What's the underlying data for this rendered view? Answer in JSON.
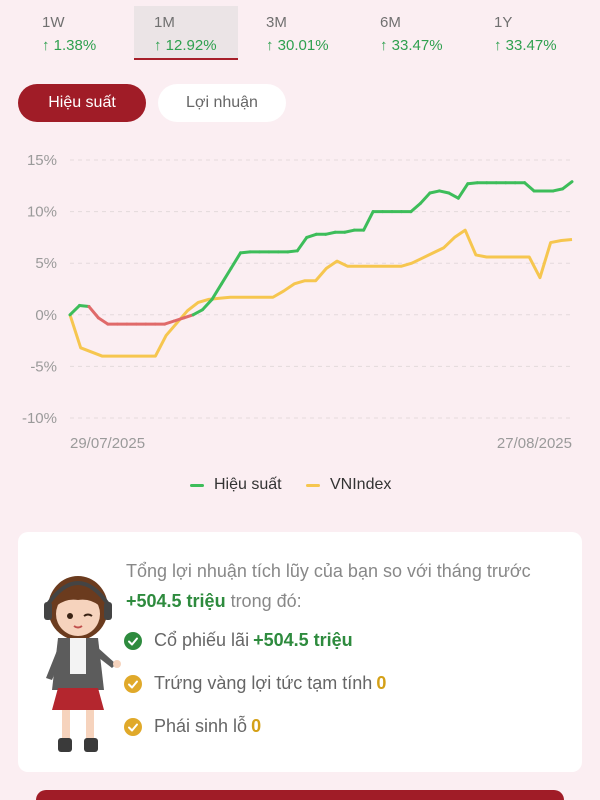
{
  "periods": [
    {
      "label": "1W",
      "change": "↑ 1.38%"
    },
    {
      "label": "1M",
      "change": "↑ 12.92%"
    },
    {
      "label": "3M",
      "change": "↑ 30.01%"
    },
    {
      "label": "6M",
      "change": "↑ 33.47%"
    },
    {
      "label": "1Y",
      "change": "↑ 33.47%"
    }
  ],
  "tabs": {
    "performance": "Hiệu suất",
    "profit": "Lợi nhuận"
  },
  "chart_data": {
    "type": "line",
    "y_ticks": [
      "15%",
      "10%",
      "5%",
      "0%",
      "-5%",
      "-10%"
    ],
    "ylim": [
      -10,
      15
    ],
    "x_start_label": "29/07/2025",
    "x_end_label": "27/08/2025",
    "grid": true,
    "legend_placement": "bottom-center",
    "series": [
      {
        "name": "Hiệu suất",
        "color": "#3dbd5a",
        "negative_color": "#e06a6a",
        "values": [
          0,
          0.9,
          0.8,
          -0.3,
          -0.9,
          -0.9,
          -0.9,
          -0.9,
          -0.9,
          -0.9,
          -0.9,
          -0.6,
          -0.3,
          0,
          0.5,
          1.5,
          3,
          4.5,
          6,
          6.1,
          6.1,
          6.1,
          6.1,
          6.1,
          6.2,
          7.5,
          7.8,
          7.8,
          8,
          8,
          8.2,
          8.2,
          10,
          10,
          10,
          10,
          10,
          10.8,
          11.8,
          12,
          11.8,
          11.3,
          12.7,
          12.8,
          12.8,
          12.8,
          12.8,
          12.8,
          12.8,
          12,
          12,
          12,
          12.2,
          12.9
        ]
      },
      {
        "name": "VNIndex",
        "color": "#f6c64f",
        "values": [
          0,
          -3.2,
          -3.6,
          -4,
          -4,
          -4,
          -4,
          -4,
          -4,
          -2,
          -0.8,
          0.4,
          1.2,
          1.5,
          1.6,
          1.7,
          1.7,
          1.7,
          1.7,
          1.7,
          2.3,
          3,
          3.3,
          3.3,
          4.5,
          5.2,
          4.7,
          4.7,
          4.7,
          4.7,
          4.7,
          4.7,
          5,
          5.5,
          6,
          6.5,
          7.5,
          8.2,
          5.8,
          5.6,
          5.6,
          5.6,
          5.6,
          5.6,
          3.6,
          7,
          7.2,
          7.3
        ]
      }
    ]
  },
  "legend": {
    "performance": "Hiệu suất",
    "index": "VNIndex"
  },
  "summary": {
    "text_prefix": "Tổng lợi nhuận tích lũy của bạn so với tháng trước ",
    "total_value": "+504.5 triệu",
    "text_suffix": " trong đó:",
    "rows": [
      {
        "label": "Cổ phiếu lãi ",
        "value": "+504.5 triệu",
        "icon": "check-circle-green"
      },
      {
        "label": "Trứng vàng lợi tức tạm tính ",
        "value": "0",
        "icon": "check-circle-gold"
      },
      {
        "label": "Phái sinh lỗ ",
        "value": "0",
        "icon": "check-circle-gold"
      }
    ]
  },
  "colors": {
    "accent": "#a01c27",
    "green": "#2e8b3e",
    "gold": "#d4a017",
    "background": "#fbeef2"
  }
}
